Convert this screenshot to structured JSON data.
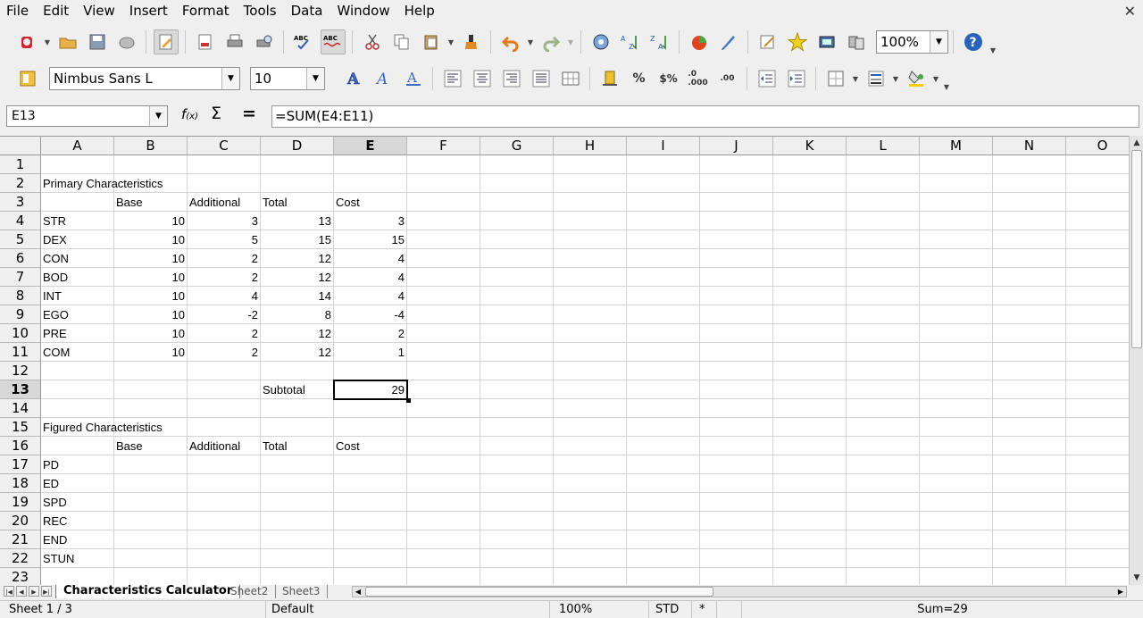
{
  "menu": [
    "File",
    "Edit",
    "View",
    "Insert",
    "Format",
    "Tools",
    "Data",
    "Window",
    "Help"
  ],
  "toolbar": {
    "font_name": "Nimbus Sans L",
    "font_size": "10",
    "zoom": "100%"
  },
  "formula_bar": {
    "cell_ref": "E13",
    "formula": "=SUM(E4:E11)"
  },
  "columns": [
    "A",
    "B",
    "C",
    "D",
    "E",
    "F",
    "G",
    "H",
    "I",
    "J",
    "K",
    "L",
    "M",
    "N",
    "O"
  ],
  "rows": [
    "1",
    "2",
    "3",
    "4",
    "5",
    "6",
    "7",
    "8",
    "9",
    "10",
    "11",
    "12",
    "13",
    "14",
    "15",
    "16",
    "17",
    "18",
    "19",
    "20",
    "21",
    "22",
    "23"
  ],
  "selected": {
    "col": "E",
    "row": "13"
  },
  "sheet": {
    "section1_title": "Primary Characteristics",
    "section2_title": "Figured Characteristics",
    "headers": [
      "Base",
      "Additional",
      "Total",
      "Cost"
    ],
    "primary": [
      {
        "name": "STR",
        "base": "10",
        "additional": "3",
        "total": "13",
        "cost": "3"
      },
      {
        "name": "DEX",
        "base": "10",
        "additional": "5",
        "total": "15",
        "cost": "15"
      },
      {
        "name": "CON",
        "base": "10",
        "additional": "2",
        "total": "12",
        "cost": "4"
      },
      {
        "name": "BOD",
        "base": "10",
        "additional": "2",
        "total": "12",
        "cost": "4"
      },
      {
        "name": "INT",
        "base": "10",
        "additional": "4",
        "total": "14",
        "cost": "4"
      },
      {
        "name": "EGO",
        "base": "10",
        "additional": "-2",
        "total": "8",
        "cost": "-4"
      },
      {
        "name": "PRE",
        "base": "10",
        "additional": "2",
        "total": "12",
        "cost": "2"
      },
      {
        "name": "COM",
        "base": "10",
        "additional": "2",
        "total": "12",
        "cost": "1"
      }
    ],
    "subtotal_label": "Subtotal",
    "subtotal_value": "29",
    "figured": [
      "PD",
      "ED",
      "SPD",
      "REC",
      "END",
      "STUN"
    ]
  },
  "tabs": [
    "Characteristics Calculator",
    "Sheet2",
    "Sheet3"
  ],
  "status": {
    "sheet": "Sheet 1 / 3",
    "style": "Default",
    "zoom": "100%",
    "mode": "STD",
    "modified": "*",
    "sum": "Sum=29"
  }
}
